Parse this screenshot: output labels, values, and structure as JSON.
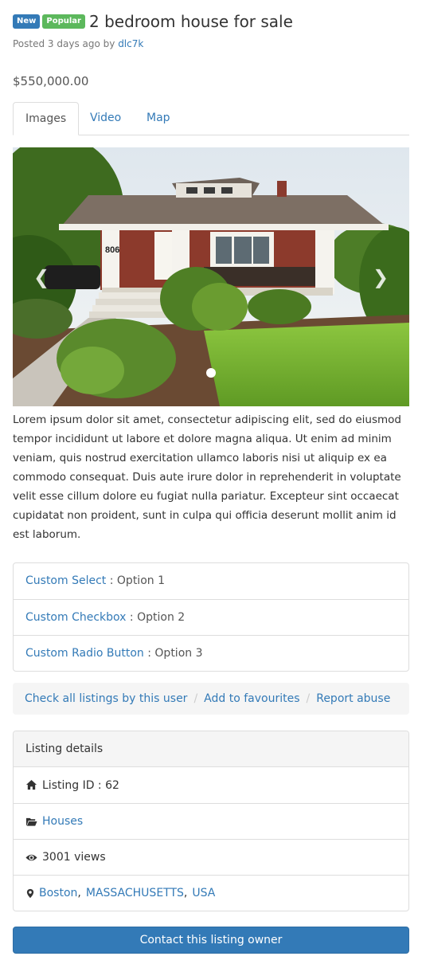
{
  "listing": {
    "badges": {
      "new": "New",
      "popular": "Popular"
    },
    "title": "2 bedroom house for sale",
    "meta": {
      "posted": "Posted 3 days ago by",
      "user": "dlc7k"
    },
    "price": "$550,000.00"
  },
  "tabs": [
    {
      "label": "Images",
      "active": true
    },
    {
      "label": "Video",
      "active": false
    },
    {
      "label": "Map",
      "active": false
    }
  ],
  "carousel": {
    "house_number": "806",
    "prev_icon": "chevron-left-icon",
    "next_icon": "chevron-right-icon",
    "slide_count": 1,
    "active_slide": 1
  },
  "description": "Lorem ipsum dolor sit amet, consectetur adipiscing elit, sed do eiusmod tempor incididunt ut labore et dolore magna aliqua. Ut enim ad minim veniam, quis nostrud exercitation ullamco laboris nisi ut aliquip ex ea commodo consequat. Duis aute irure dolor in reprehenderit in voluptate velit esse cillum dolore eu fugiat nulla pariatur. Excepteur sint occaecat cupidatat non proident, sunt in culpa qui officia deserunt mollit anim id est laborum.",
  "attributes": [
    {
      "label": "Custom Select",
      "value": "Option 1"
    },
    {
      "label": "Custom Checkbox",
      "value": "Option 2"
    },
    {
      "label": "Custom Radio Button",
      "value": "Option 3"
    }
  ],
  "attr_separator": " : ",
  "actions": {
    "check_listings": "Check all listings by this user",
    "favourites": "Add to favourites",
    "report": "Report abuse",
    "separator": "/"
  },
  "details": {
    "heading": "Listing details",
    "listing_id": "Listing ID : 62",
    "category": "Houses",
    "views": "3001 views",
    "location": {
      "city": "Boston",
      "state": "MASSACHUSETTS",
      "country": "USA",
      "separator": ","
    },
    "icons": {
      "id": "home-icon",
      "category": "folder-open-icon",
      "views": "eye-icon",
      "location": "map-marker-icon"
    }
  },
  "contact_button": "Contact this listing owner",
  "colors": {
    "primary": "#337ab7",
    "success": "#5cb85c",
    "border": "#dddddd",
    "panel": "#f5f5f5"
  }
}
